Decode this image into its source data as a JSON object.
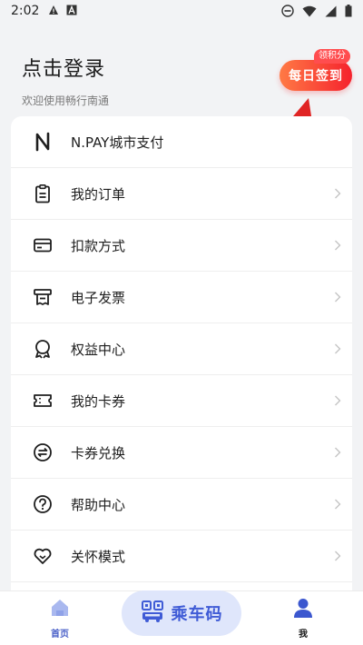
{
  "status_bar": {
    "time": "2:02",
    "icons": [
      "alert-icon",
      "a-icon",
      "dnd-icon",
      "wifi-icon",
      "signal-icon",
      "battery-icon"
    ]
  },
  "header": {
    "login_title": "点击登录",
    "welcome": "欢迎使用畅行南通"
  },
  "signin": {
    "badge": "领积分",
    "label": "每日签到",
    "colors": [
      "#ff7a45",
      "#f5222d"
    ]
  },
  "menu": {
    "items": [
      {
        "label": "N.PAY城市支付",
        "icon": "npay-logo-icon",
        "chevron": false
      },
      {
        "label": "我的订单",
        "icon": "clipboard-icon",
        "chevron": true
      },
      {
        "label": "扣款方式",
        "icon": "card-icon",
        "chevron": true
      },
      {
        "label": "电子发票",
        "icon": "invoice-icon",
        "chevron": true
      },
      {
        "label": "权益中心",
        "icon": "badge-icon",
        "chevron": true
      },
      {
        "label": "我的卡券",
        "icon": "ticket-icon",
        "chevron": true
      },
      {
        "label": "卡券兑换",
        "icon": "exchange-icon",
        "chevron": true
      },
      {
        "label": "帮助中心",
        "icon": "help-icon",
        "chevron": true
      },
      {
        "label": "关怀模式",
        "icon": "heart-icon",
        "chevron": true
      }
    ]
  },
  "tabs": {
    "home": "首页",
    "ride": "乘车码",
    "me": "我"
  },
  "colors": {
    "accent": "#3f5bd6",
    "annotation_arrow": "#e02424"
  }
}
